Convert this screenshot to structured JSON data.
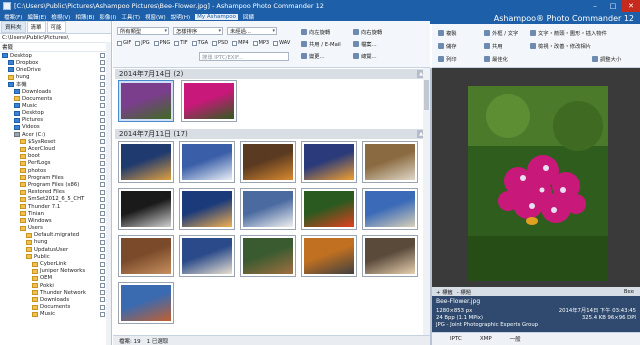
{
  "window": {
    "title": "[C:\\Users\\Public\\Pictures\\Ashampoo Pictures\\Bee-Flower.jpg] - Ashampoo Photo Commander 12",
    "brand": "Ashampoo® Photo Commander 12",
    "min": "–",
    "max": "□",
    "close": "✕"
  },
  "menu": [
    "檔案(F)",
    "編輯(E)",
    "檢視(V)",
    "相簿(B)",
    "影像(I)",
    "工具(T)",
    "視窗(W)",
    "說明(H)",
    "My Ashampoo",
    "回饋"
  ],
  "left": {
    "tabs": [
      "資料夾",
      "清單",
      "可能"
    ],
    "path": "C:\\Users\\Public\\Pictures\\",
    "view_label": "書籤",
    "tree": [
      {
        "label": "Desktop",
        "indent": 0,
        "icon": "blue"
      },
      {
        "label": "Dropbox",
        "indent": 1,
        "icon": "blue"
      },
      {
        "label": "OneDrive",
        "indent": 1,
        "icon": "blue"
      },
      {
        "label": "hung",
        "indent": 1,
        "icon": "folder"
      },
      {
        "label": "本機",
        "indent": 1,
        "icon": "blue"
      },
      {
        "label": "Downloads",
        "indent": 2,
        "icon": "blue"
      },
      {
        "label": "Documents",
        "indent": 2,
        "icon": "folder"
      },
      {
        "label": "Music",
        "indent": 2,
        "icon": "blue"
      },
      {
        "label": "Desktop",
        "indent": 2,
        "icon": "blue"
      },
      {
        "label": "Pictures",
        "indent": 2,
        "icon": "blue"
      },
      {
        "label": "Videos",
        "indent": 2,
        "icon": "blue"
      },
      {
        "label": "Acer (C:)",
        "indent": 2,
        "icon": "drive"
      },
      {
        "label": "$SysReset",
        "indent": 3,
        "icon": "folder"
      },
      {
        "label": "AcerCloud",
        "indent": 3,
        "icon": "folder"
      },
      {
        "label": "boot",
        "indent": 3,
        "icon": "folder"
      },
      {
        "label": "PerfLogs",
        "indent": 3,
        "icon": "folder"
      },
      {
        "label": "photos",
        "indent": 3,
        "icon": "folder"
      },
      {
        "label": "Program Files",
        "indent": 3,
        "icon": "folder"
      },
      {
        "label": "Program Files (x86)",
        "indent": 3,
        "icon": "folder"
      },
      {
        "label": "Restored Files",
        "indent": 3,
        "icon": "folder"
      },
      {
        "label": "SmSet2012_6_5_CHT",
        "indent": 3,
        "icon": "folder"
      },
      {
        "label": "Thunder 7.1",
        "indent": 3,
        "icon": "folder"
      },
      {
        "label": "Tinian",
        "indent": 3,
        "icon": "folder"
      },
      {
        "label": "Windows",
        "indent": 3,
        "icon": "folder"
      },
      {
        "label": "Users",
        "indent": 3,
        "icon": "folder"
      },
      {
        "label": "Default.migrated",
        "indent": 4,
        "icon": "folder"
      },
      {
        "label": "hung",
        "indent": 4,
        "icon": "folder"
      },
      {
        "label": "UpdatusUser",
        "indent": 4,
        "icon": "folder"
      },
      {
        "label": "Public",
        "indent": 4,
        "icon": "folder"
      },
      {
        "label": "CyberLink",
        "indent": 5,
        "icon": "folder"
      },
      {
        "label": "Juniper Networks",
        "indent": 5,
        "icon": "folder"
      },
      {
        "label": "OEM",
        "indent": 5,
        "icon": "folder"
      },
      {
        "label": "Pokki",
        "indent": 5,
        "icon": "folder"
      },
      {
        "label": "Thunder Network",
        "indent": 5,
        "icon": "folder"
      },
      {
        "label": "Downloads",
        "indent": 5,
        "icon": "folder"
      },
      {
        "label": "Documents",
        "indent": 5,
        "icon": "folder"
      },
      {
        "label": "Music",
        "indent": 5,
        "icon": "folder"
      }
    ]
  },
  "toolbar": {
    "type_select": "所有類型",
    "sort_select": "怎樣排序",
    "filter_select": "未經過...",
    "checks": [
      "GIF",
      "JPG",
      "PNG",
      "TIF",
      "TGA",
      "PSD",
      "MP4",
      "MP3",
      "WAV"
    ],
    "search_placeholder": "搜尋 IPTC/EXIF...",
    "actions": [
      "向左旋轉",
      "共用 / E-Mail",
      "變更...",
      "向右旋轉",
      "檔案...",
      "總覽..."
    ]
  },
  "right_toolbar": {
    "actions": [
      "複製",
      "外框 / 文字",
      "儲存",
      "共用",
      "列印",
      "最佳化",
      "文字・箭頭・圖形・插入物件",
      "檢視・改善・修改相片",
      "調整大小"
    ]
  },
  "groups": [
    {
      "label": "2014年7月14日 (2)"
    },
    {
      "label": "2014年7月11日 (17)"
    }
  ],
  "status": {
    "count": "檔案: 19",
    "sel": "1 已選取"
  },
  "preview_bar": {
    "left": "+ 標籤",
    "mid": "- 標題",
    "right": "Bee"
  },
  "info": {
    "filename": "Bee-Flower.jpg",
    "rows": [
      {
        "k": "1280×853 px",
        "v": "2014年7月14日 下午 03:43:45"
      },
      {
        "k": "24 Bpp (1.1 MPix)",
        "v": "325.4 KB  96×96 DPI"
      },
      {
        "k": "JPG - Joint Photographic Experts Group",
        "v": ""
      }
    ]
  },
  "info_tabs": [
    "IPTC",
    "XMP",
    "一般"
  ]
}
